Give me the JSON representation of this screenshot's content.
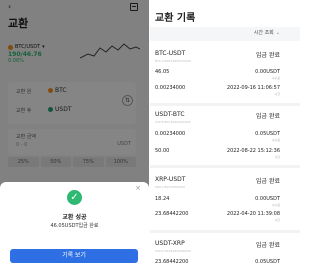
{
  "left": {
    "title": "교환",
    "pair": {
      "name": "BTC/USDT",
      "price": "190/46.76",
      "change": "0.06%"
    },
    "from_label": "교환 원",
    "from_coin": "BTC",
    "to_label": "교환 후",
    "to_coin": "USDT",
    "amount_label": "교환 금액",
    "amount_placeholder": "0 - 0",
    "amount_unit": "USDT",
    "percents": [
      "25%",
      "50%",
      "75%",
      "100%"
    ],
    "dialog": {
      "close": "×",
      "title": "교환 성공",
      "message": "46.05USDT입금 완료",
      "button": "기록 보기"
    }
  },
  "right": {
    "title": "교환 기록",
    "filter": "시간 조회",
    "records": [
      {
        "pair": "BTC-USDT",
        "id": "BTC-USDT1665570000",
        "status": "입금 완료",
        "a1": "46.05",
        "b1": "0.00USDT",
        "b1_sub": "수수료",
        "a2": "0.00234000",
        "b2": "2022-09-16 11:06:57",
        "b2_sub": "시간"
      },
      {
        "pair": "USDT-BTC",
        "id": "USDT-BTC1660000000",
        "status": "입금 완료",
        "a1": "0.00234000",
        "b1": "0.05USDT",
        "b1_sub": "수수료",
        "a2": "50.00",
        "b2": "2022-08-22 15:12:36",
        "b2_sub": "시간"
      },
      {
        "pair": "XRP-USDT",
        "id": "XRP-USDT1650000",
        "status": "입금 완료",
        "a1": "18.24",
        "b1": "0.00USDT",
        "b1_sub": "수수료",
        "a2": "23.68442200",
        "b2": "2022-04-20 11:39:08",
        "b2_sub": "시간"
      },
      {
        "pair": "USDT-XRP",
        "id": "USDT-XRP1650000000",
        "status": "입금 완료",
        "a1": "23.68442200",
        "b1": "0.05USDT",
        "b1_sub": "",
        "a2": "",
        "b2": "",
        "b2_sub": ""
      }
    ]
  }
}
